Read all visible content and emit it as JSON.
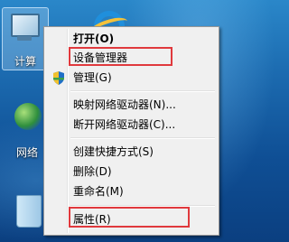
{
  "desktop": {
    "icons": [
      {
        "label": "计算"
      },
      {
        "label": ""
      },
      {
        "label": "网络"
      },
      {
        "label": ""
      }
    ]
  },
  "context_menu": {
    "items": [
      {
        "label": "打开(O)",
        "bold": true
      },
      {
        "label": "设备管理器",
        "highlighted": true
      },
      {
        "label": "管理(G)",
        "icon": "shield-icon"
      },
      {
        "label": "映射网络驱动器(N)..."
      },
      {
        "label": "断开网络驱动器(C)..."
      },
      {
        "label": "创建快捷方式(S)"
      },
      {
        "label": "删除(D)"
      },
      {
        "label": "重命名(M)"
      },
      {
        "label": "属性(R)",
        "highlighted": true
      }
    ]
  },
  "colors": {
    "highlight_border": "#e0393d",
    "menu_background": "#f0f0f0"
  }
}
